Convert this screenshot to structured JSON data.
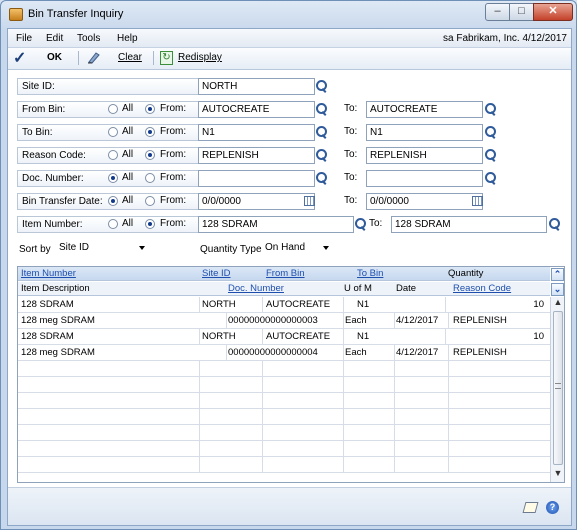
{
  "window": {
    "title": "Bin Transfer Inquiry"
  },
  "menu": {
    "items": [
      "File",
      "Edit",
      "Tools",
      "Help"
    ],
    "company": "sa  Fabrikam, Inc.  4/12/2017"
  },
  "toolbar": {
    "ok": "OK",
    "clear": "Clear",
    "redisplay": "Redisplay"
  },
  "form": {
    "site_label": "Site ID:",
    "site_value": "NORTH",
    "all": "All",
    "from": "From:",
    "to": "To:",
    "from_bin": {
      "label": "From Bin:",
      "from": "AUTOCREATE",
      "to": "AUTOCREATE",
      "mode": "from"
    },
    "to_bin": {
      "label": "To Bin:",
      "from": "N1",
      "to": "N1",
      "mode": "from"
    },
    "reason": {
      "label": "Reason Code:",
      "from": "REPLENISH",
      "to": "REPLENISH",
      "mode": "from"
    },
    "doc": {
      "label": "Doc. Number:",
      "from": "",
      "to": "",
      "mode": "all"
    },
    "date": {
      "label": "Bin Transfer Date:",
      "from": "0/0/0000",
      "to": "0/0/0000",
      "mode": "all"
    },
    "item": {
      "label": "Item Number:",
      "from": "128 SDRAM",
      "to": "128 SDRAM",
      "mode": "from"
    },
    "sort_label": "Sort by",
    "sort_value": "Site ID",
    "qtype_label": "Quantity Type",
    "qtype_value": "On Hand"
  },
  "grid": {
    "headers1": [
      "Item Number",
      "Site ID",
      "From Bin",
      "To Bin",
      "Quantity"
    ],
    "headers2": [
      "Item Description",
      "Doc. Number",
      "U of M",
      "Date",
      "Reason Code"
    ],
    "rows": [
      [
        "128 SDRAM",
        "NORTH",
        "AUTOCREATE",
        "N1",
        "",
        "10"
      ],
      [
        "128 meg SDRAM",
        "00000000000000003",
        "Each",
        "4/12/2017",
        "REPLENISH",
        ""
      ],
      [
        "128 SDRAM",
        "NORTH",
        "AUTOCREATE",
        "N1",
        "",
        "10"
      ],
      [
        "128 meg SDRAM",
        "00000000000000004",
        "Each",
        "4/12/2017",
        "REPLENISH",
        ""
      ]
    ]
  },
  "icons": [
    "app-icon",
    "ok-check-icon",
    "clear-icon",
    "redisplay-icon",
    "lookup-icon",
    "calendar-icon",
    "note-icon",
    "help-icon"
  ]
}
